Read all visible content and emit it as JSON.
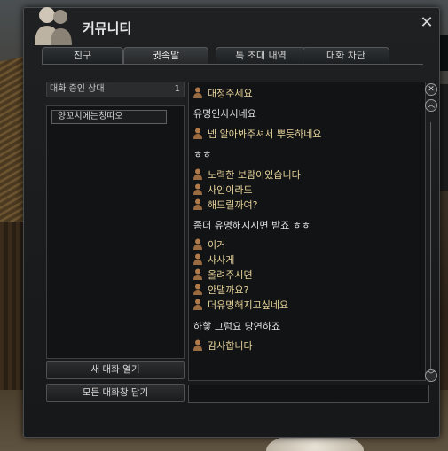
{
  "window": {
    "title": "커뮤니티",
    "close_icon": "close-icon"
  },
  "tabs": [
    {
      "label": "친구",
      "active": false
    },
    {
      "label": "귓속말",
      "active": true
    },
    {
      "label": "톡 초대 내역",
      "active": false
    },
    {
      "label": "대화 차단",
      "active": false
    }
  ],
  "sidebar": {
    "status_label": "대화 중인 상대",
    "status_count": "1",
    "contacts": [
      "양꼬치에는칭따오"
    ],
    "open_chat_button": "새 대화 열기",
    "close_all_button": "모든 대화창 닫기"
  },
  "chat": {
    "messages": [
      {
        "speaker": "me",
        "text": "대청주세요"
      },
      {
        "speaker": "them",
        "text": "유명인사시네요"
      },
      {
        "speaker": "me",
        "text": "넵 알아봐주셔서 뿌듯하네요"
      },
      {
        "speaker": "them",
        "text": "ㅎㅎ"
      },
      {
        "speaker": "me",
        "text": "노력한 보람이있습니다"
      },
      {
        "speaker": "me",
        "text": "사인이라도"
      },
      {
        "speaker": "me",
        "text": "해드릴까여?"
      },
      {
        "speaker": "them",
        "text": "좀더 유명해지시면 받죠 ㅎㅎ"
      },
      {
        "speaker": "me",
        "text": "이거"
      },
      {
        "speaker": "me",
        "text": "사사게"
      },
      {
        "speaker": "me",
        "text": "올려주시면"
      },
      {
        "speaker": "me",
        "text": "안댈까요?"
      },
      {
        "speaker": "me",
        "text": "더유명해지고싶네요"
      },
      {
        "speaker": "them",
        "text": "하핳 그럼요 당연하죠"
      },
      {
        "speaker": "me",
        "text": "감사합니다"
      }
    ],
    "input_value": ""
  },
  "colors": {
    "my_text": "#e7d49b",
    "their_text": "#e0e0e0",
    "window_bg": "#1e2022"
  },
  "icons": {
    "speaker": "person-icon",
    "scroll_up": "chevron-up-icon",
    "scroll_down": "chevron-down-icon",
    "close_chat": "close-circle-icon"
  }
}
